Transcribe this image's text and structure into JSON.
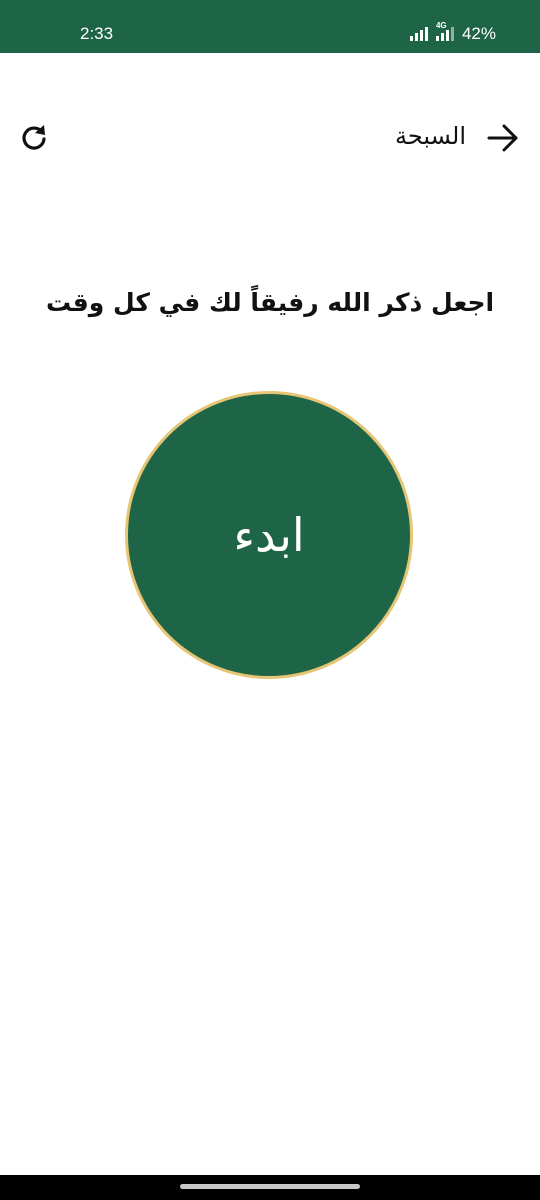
{
  "status_bar": {
    "time": "2:33",
    "network_label": "4G",
    "battery": "42%",
    "color": "#1e6446"
  },
  "toolbar": {
    "title": "السبحة",
    "back_icon": "arrow-right-icon",
    "refresh_icon": "refresh-icon"
  },
  "main": {
    "tagline": "اجعل ذكر الله رفيقاً لك في كل وقت",
    "start_label": "ابدء",
    "button_color": "#1e6446",
    "button_border_color": "#e6c574"
  }
}
